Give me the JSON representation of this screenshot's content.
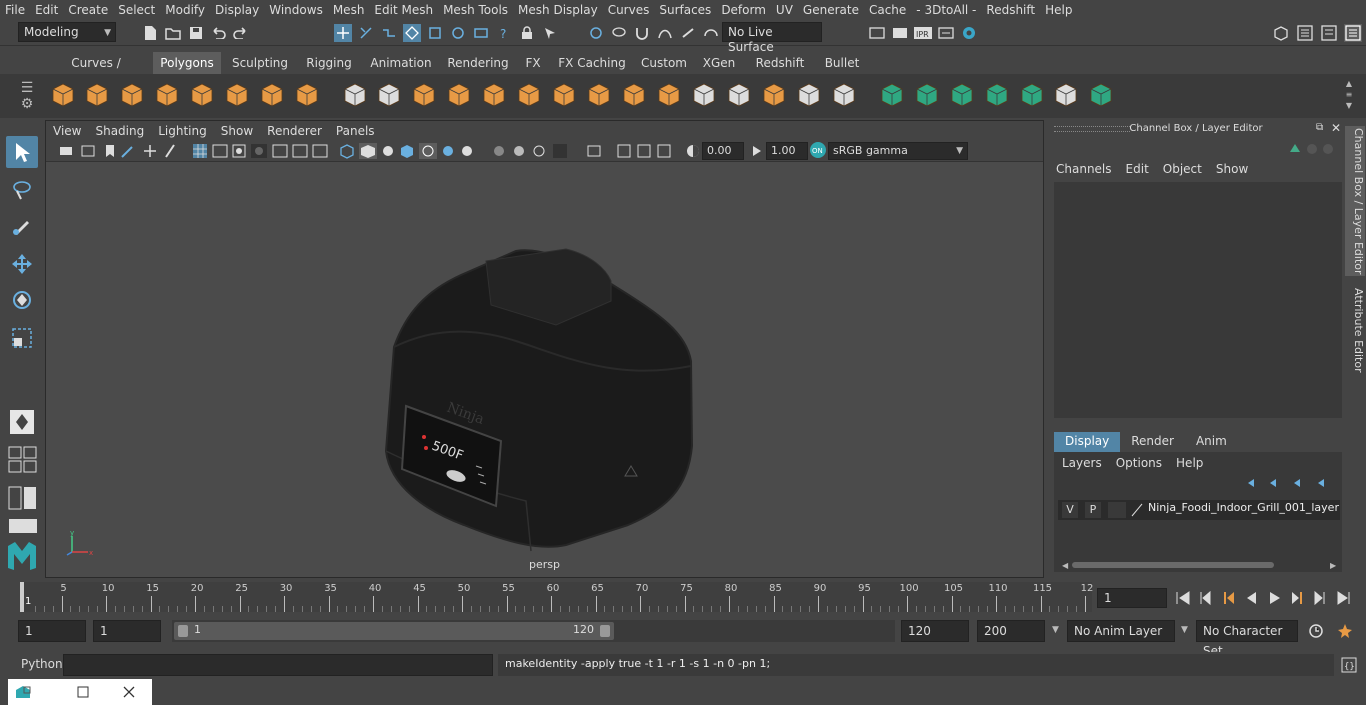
{
  "menubar": [
    "File",
    "Edit",
    "Create",
    "Select",
    "Modify",
    "Display",
    "Windows",
    "Mesh",
    "Edit Mesh",
    "Mesh Tools",
    "Mesh Display",
    "Curves",
    "Surfaces",
    "Deform",
    "UV",
    "Generate",
    "Cache",
    "- 3DtoAll -",
    "Redshift",
    "Help"
  ],
  "status": {
    "mode": "Modeling",
    "live_surface": "No Live Surface"
  },
  "shelf_tabs": [
    "Curves / Surfaces",
    "Polygons",
    "Sculpting",
    "Rigging",
    "Animation",
    "Rendering",
    "FX",
    "FX Caching",
    "Custom",
    "XGen",
    "Redshift",
    "Bullet"
  ],
  "shelf_active": "Polygons",
  "viewport": {
    "menus": [
      "View",
      "Shading",
      "Lighting",
      "Show",
      "Renderer",
      "Panels"
    ],
    "exposure": "0.00",
    "gamma": "1.00",
    "colorspace": "sRGB gamma",
    "camera_label": "persp",
    "product_text": "Ninja",
    "display_text": "500F"
  },
  "channel_box": {
    "title": "Channel Box / Layer Editor",
    "menus": [
      "Channels",
      "Edit",
      "Object",
      "Show"
    ],
    "layer_tabs": [
      "Display",
      "Render",
      "Anim"
    ],
    "layer_tab_active": "Display",
    "layer_menus": [
      "Layers",
      "Options",
      "Help"
    ],
    "layer": {
      "v": "V",
      "p": "P",
      "name": "Ninja_Foodi_Indoor_Grill_001_layer"
    }
  },
  "side_tabs": {
    "channel": "Channel Box / Layer Editor",
    "attribute": "Attribute Editor"
  },
  "timeline": {
    "ticks": [
      "5",
      "10",
      "15",
      "20",
      "25",
      "30",
      "35",
      "40",
      "45",
      "50",
      "55",
      "60",
      "65",
      "70",
      "75",
      "80",
      "85",
      "90",
      "95",
      "100",
      "105",
      "110",
      "115",
      "12"
    ],
    "start_tick": "1",
    "current_frame": "1"
  },
  "range": {
    "start": "1",
    "playback_start": "1",
    "slider_start": "1",
    "slider_end": "120",
    "playback_end": "120",
    "end": "200",
    "anim_layer": "No Anim Layer",
    "character_set": "No Character Set"
  },
  "cmdline": {
    "lang": "Python",
    "input": "",
    "result": "makeIdentity -apply true -t 1 -r 1 -s 1 -n 0 -pn 1;"
  },
  "colors": {
    "accent": "#5285a6",
    "shelf_orange": "#e79a45",
    "shelf_green": "#2fa882",
    "selected_tab": "#5d5d5d"
  }
}
